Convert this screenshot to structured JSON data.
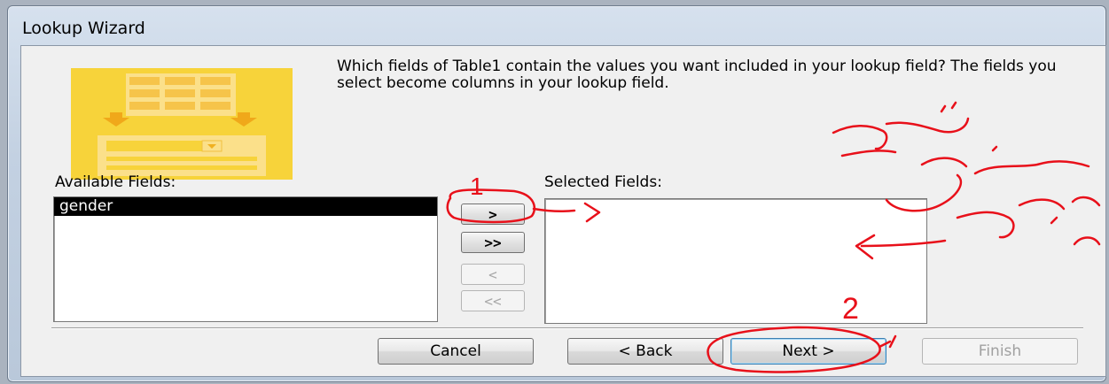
{
  "window": {
    "title": "Lookup Wizard"
  },
  "instructions": "Which fields of Table1 contain the values you want included in your lookup field? The fields you select become columns in your lookup field.",
  "available": {
    "label": "Available Fields:",
    "items": [
      "gender"
    ]
  },
  "selected": {
    "label": "Selected Fields:",
    "items": []
  },
  "move_buttons": {
    "add_one": ">",
    "add_all": ">>",
    "remove_one": "<",
    "remove_all": "<<"
  },
  "footer": {
    "cancel": "Cancel",
    "back": "< Back",
    "next": "Next >",
    "finish": "Finish"
  },
  "annotations": {
    "step1": "1",
    "step2": "2",
    "accent": "#e8101a"
  },
  "colors": {
    "banner": "#f7d33a",
    "banner_light": "#fbe08a",
    "selection": "#000000"
  }
}
